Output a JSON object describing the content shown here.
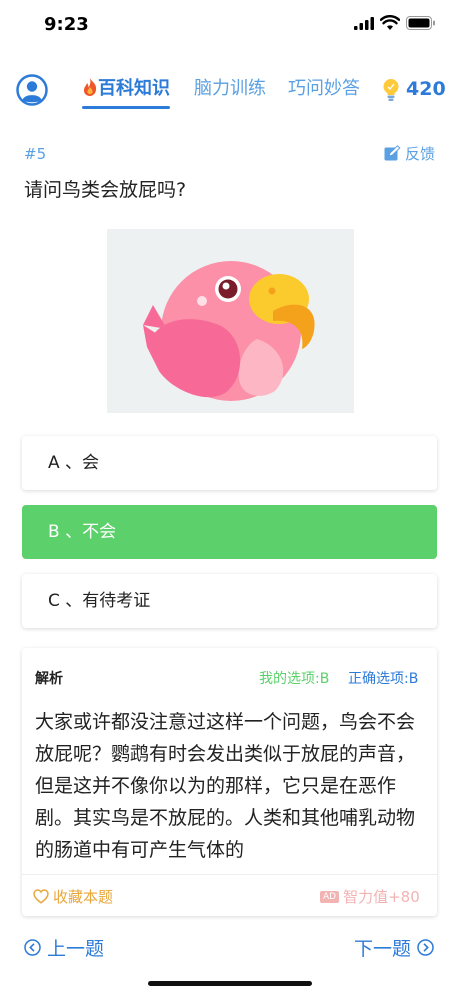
{
  "status": {
    "time": "9:23"
  },
  "header": {
    "tabs": [
      {
        "label": "百科知识",
        "active": true
      },
      {
        "label": "脑力训练",
        "active": false
      },
      {
        "label": "巧问妙答",
        "active": false
      }
    ],
    "score": "420"
  },
  "question": {
    "number": "#5",
    "feedback_label": "反馈",
    "text": "请问鸟类会放屁吗?"
  },
  "options": [
    {
      "label": "A 、会",
      "state": "normal"
    },
    {
      "label": "B 、不会",
      "state": "correct"
    },
    {
      "label": "C 、有待考证",
      "state": "normal"
    }
  ],
  "analysis": {
    "title": "解析",
    "my_choice": "我的选项:B",
    "correct_choice": "正确选项:B",
    "body": "大家或许都没注意过这样一个问题，鸟会不会放屁呢？鹦鹉有时会发出类似于放屁的声音，但是这并不像你以为的那样，它只是在恶作剧。其实鸟是不放屁的。人类和其他哺乳动物的肠道中有可产生气体的",
    "favorite_label": "收藏本题",
    "ad_badge": "AD",
    "reward_label": "智力值+80"
  },
  "nav": {
    "prev_label": "上一题",
    "next_label": "下一题"
  },
  "colors": {
    "accent": "#2d7bd8",
    "correct": "#5cd06a",
    "favorite": "#e8a73c"
  }
}
